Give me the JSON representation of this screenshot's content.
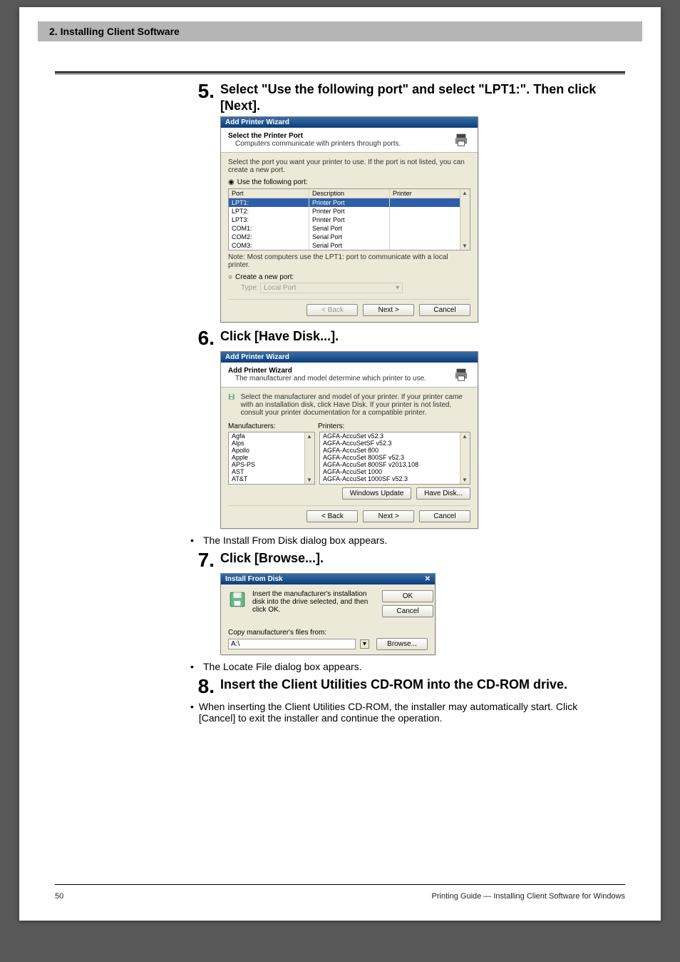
{
  "header": {
    "chapterTitle": "2. Installing Client Software"
  },
  "hrColor": "#000000",
  "steps": {
    "s5": {
      "num": "5.",
      "text": "Select \"Use the following port\" and select \"LPT1:\".  Then click [Next].",
      "dialog": {
        "title": "Add Printer Wizard",
        "hdrTitle": "Select the Printer Port",
        "hdrSub": "Computers communicate with printers through ports.",
        "intro": "Select the port you want your printer to use. If the port is not listed, you can create a new port.",
        "radioUse": "Use the following port:",
        "tableHead": {
          "c1": "Port",
          "c2": "Description",
          "c3": "Printer"
        },
        "rows": [
          {
            "c1": "LPT1:",
            "c2": "Printer Port",
            "c3": "",
            "sel": true
          },
          {
            "c1": "LPT2:",
            "c2": "Printer Port",
            "c3": ""
          },
          {
            "c1": "LPT3:",
            "c2": "Printer Port",
            "c3": ""
          },
          {
            "c1": "COM1:",
            "c2": "Serial Port",
            "c3": ""
          },
          {
            "c1": "COM2:",
            "c2": "Serial Port",
            "c3": ""
          },
          {
            "c1": "COM3:",
            "c2": "Serial Port",
            "c3": ""
          }
        ],
        "note": "Note: Most computers use the LPT1: port to communicate with a local printer.",
        "radioCreate": "Create a new port:",
        "typeLabel": "Type:",
        "typeValue": "Local Port",
        "btnBack": "< Back",
        "btnNext": "Next >",
        "btnCancel": "Cancel"
      }
    },
    "s6": {
      "num": "6.",
      "text": "Click [Have Disk...].",
      "dialog": {
        "title": "Add Printer Wizard",
        "hdrTitle": "Add Printer Wizard",
        "hdrSub": "The manufacturer and model determine which printer to use.",
        "intro": "Select the manufacturer and model of your printer. If your printer came with an installation disk, click Have Disk. If your printer is not listed, consult your printer documentation for a compatible printer.",
        "mfgLabel": "Manufacturers:",
        "prnLabel": "Printers:",
        "mfgList": [
          "Agfa",
          "Alps",
          "Apollo",
          "Apple",
          "APS-PS",
          "AST",
          "AT&T"
        ],
        "prnList": [
          "AGFA-AccuSet v52.3",
          "AGFA-AccuSetSF v52.3",
          "AGFA-AccuSet 800",
          "AGFA-AccuSet 800SF v52.3",
          "AGFA-AccuSet 800SF v2013.108",
          "AGFA-AccuSet 1000",
          "AGFA-AccuSet 1000SF v52.3"
        ],
        "btnWinUpdate": "Windows Update",
        "btnHaveDisk": "Have Disk...",
        "btnBack": "< Back",
        "btnNext": "Next >",
        "btnCancel": "Cancel"
      },
      "afterNote": "The Install From Disk dialog box appears."
    },
    "s7": {
      "num": "7.",
      "text": "Click [Browse...].",
      "dialog": {
        "title": "Install From Disk",
        "msg": "Insert the manufacturer's installation disk into the drive selected, and then click OK.",
        "btnOk": "OK",
        "btnCancel": "Cancel",
        "copyLabel": "Copy manufacturer's files from:",
        "copyValue": "A:\\",
        "btnBrowse": "Browse..."
      },
      "afterNote": "The Locate File dialog box appears."
    },
    "s8": {
      "num": "8.",
      "text": "Insert the Client Utilities CD-ROM into the CD-ROM drive.",
      "afterNote": "When inserting the Client Utilities CD-ROM, the installer may automatically start. Click [Cancel] to exit the installer and continue the operation."
    }
  },
  "footer": {
    "pageNum": "50",
    "right": "Printing Guide — Installing Client Software for Windows"
  }
}
